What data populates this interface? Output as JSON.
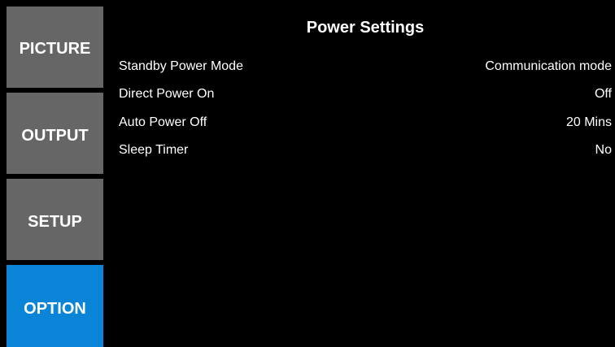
{
  "sidebar": {
    "tabs": [
      {
        "label": "PICTURE",
        "active": false
      },
      {
        "label": "OUTPUT",
        "active": false
      },
      {
        "label": "SETUP",
        "active": false
      },
      {
        "label": "OPTION",
        "active": true
      }
    ]
  },
  "panel": {
    "title": "Power Settings",
    "rows": [
      {
        "label": "Standby Power Mode",
        "value": "Communication mode"
      },
      {
        "label": "Direct Power On",
        "value": "Off"
      },
      {
        "label": "Auto Power Off",
        "value": "20 Mins"
      },
      {
        "label": "Sleep Timer",
        "value": "No"
      }
    ]
  },
  "colors": {
    "background": "#000000",
    "tab_inactive": "#666666",
    "tab_active": "#0a84d6",
    "text": "#ffffff"
  }
}
